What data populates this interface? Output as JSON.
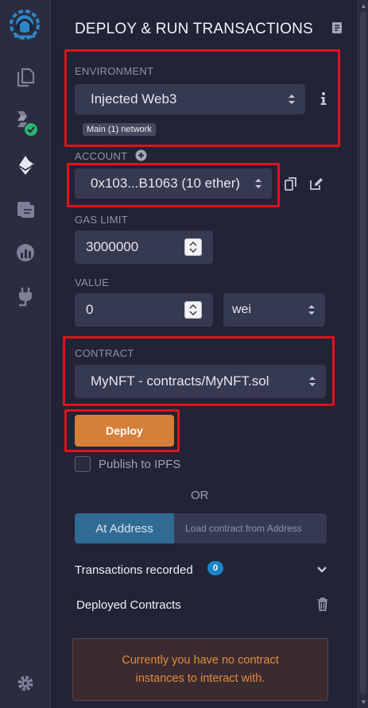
{
  "header": {
    "title": "DEPLOY & RUN TRANSACTIONS"
  },
  "environment": {
    "label": "ENVIRONMENT",
    "value": "Injected Web3",
    "network_badge": "Main (1) network"
  },
  "account": {
    "label": "ACCOUNT",
    "value": "0x103...B1063 (10 ether)"
  },
  "gas_limit": {
    "label": "GAS LIMIT",
    "value": "3000000"
  },
  "value": {
    "label": "VALUE",
    "amount": "0",
    "unit": "wei"
  },
  "contract": {
    "label": "CONTRACT",
    "value": "MyNFT - contracts/MyNFT.sol"
  },
  "deploy": {
    "button_label": "Deploy",
    "publish_label": "Publish to IPFS"
  },
  "or_label": "OR",
  "at_address": {
    "button_label": "At Address",
    "placeholder": "Load contract from Address"
  },
  "transactions": {
    "label": "Transactions recorded",
    "count": "0"
  },
  "deployed": {
    "label": "Deployed Contracts",
    "notice_line1": "Currently you have no contract",
    "notice_line2": "instances to interact with."
  },
  "colors": {
    "accent": "#1c84c6",
    "deploy": "#d5803a",
    "highlight_box": "#e0121c",
    "success": "#2bb673"
  },
  "icons": {
    "sidebar": [
      "remix-logo-icon",
      "file-explorer-icon",
      "solidity-compiler-icon",
      "deploy-run-icon",
      "debugger-icon",
      "analysis-icon",
      "plugin-manager-icon",
      "settings-icon"
    ]
  }
}
